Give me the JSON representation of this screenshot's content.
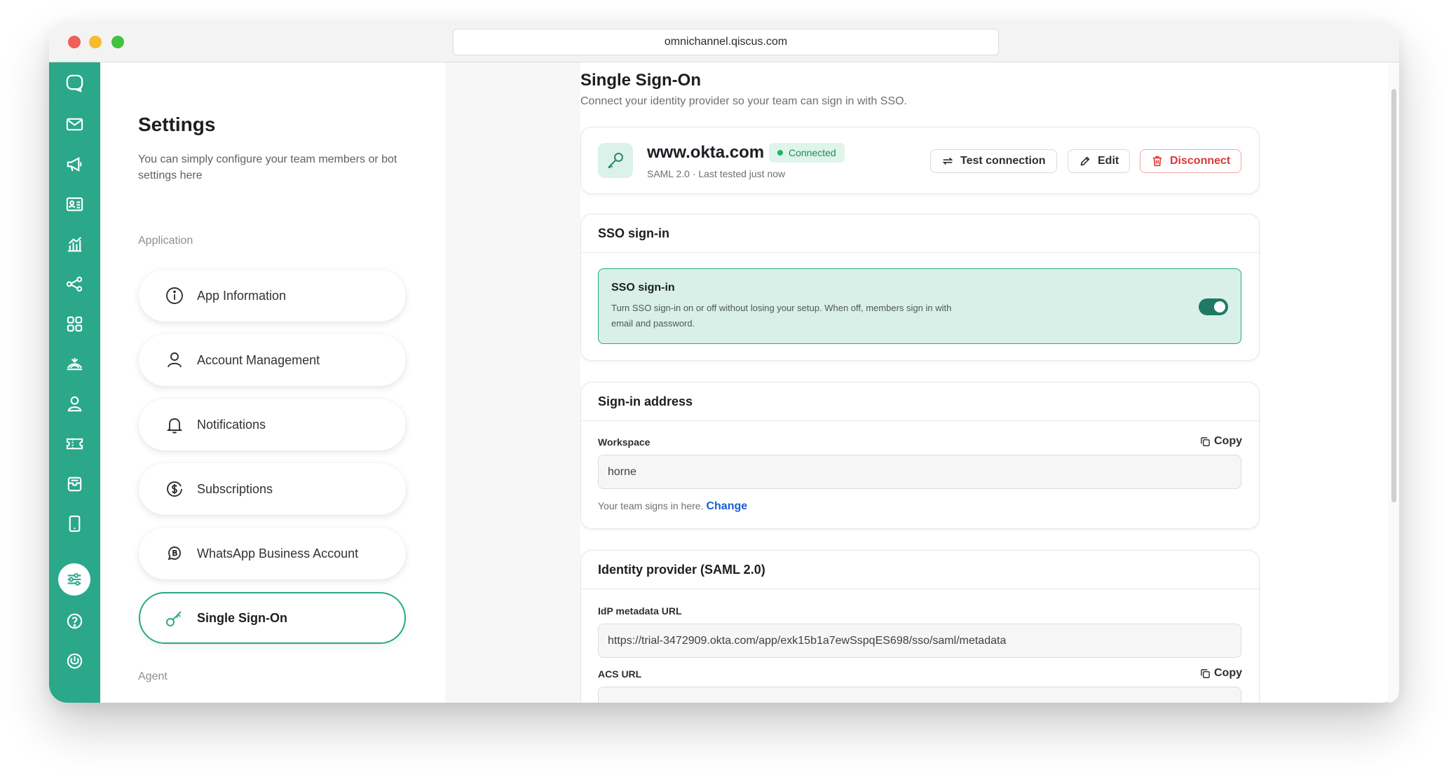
{
  "browser": {
    "url": "omnichannel.qiscus.com"
  },
  "rail": {
    "icons": [
      "chat-icon",
      "mail-icon",
      "megaphone-icon",
      "contact-card-icon",
      "analytics-icon",
      "flow-icon",
      "apps-grid-icon",
      "broadcast-icon",
      "agent-icon",
      "ticket-icon",
      "inbox-icon",
      "mobile-icon",
      "settings-sliders-icon",
      "help-icon",
      "power-icon"
    ],
    "active": "settings-sliders-icon"
  },
  "sidebar": {
    "title": "Settings",
    "description": "You can simply configure your team members or bot settings here",
    "section_application": "Application",
    "section_agent": "Agent",
    "items": [
      {
        "label": "App Information",
        "icon": "info-icon"
      },
      {
        "label": "Account Management",
        "icon": "user-icon"
      },
      {
        "label": "Notifications",
        "icon": "bell-icon"
      },
      {
        "label": "Subscriptions",
        "icon": "subscription-icon"
      },
      {
        "label": "WhatsApp Business Account",
        "icon": "whatsapp-business-icon"
      },
      {
        "label": "Single Sign-On",
        "icon": "key-icon",
        "active": true
      }
    ]
  },
  "page": {
    "title": "Single Sign-On",
    "subtitle": "Connect your identity provider so your team can sign in with SSO."
  },
  "provider": {
    "name": "www.okta.com",
    "status": "Connected",
    "meta": "SAML 2.0 · Last tested just now",
    "buttons": {
      "test": "Test connection",
      "edit": "Edit",
      "disconnect": "Disconnect"
    }
  },
  "sso": {
    "header": "SSO sign-in",
    "box_title": "SSO sign-in",
    "box_desc": "Turn SSO sign-in on or off without losing your setup. When off, members sign in with email and password.",
    "enabled": true
  },
  "signin_address": {
    "header": "Sign-in address",
    "label": "Workspace",
    "copy": "Copy",
    "value": "horne",
    "hint": "Your team signs in here.",
    "change": "Change"
  },
  "idp": {
    "header": "Identity provider (SAML 2.0)",
    "metadata_label": "IdP metadata URL",
    "metadata_value": "https://trial-3472909.okta.com/app/exk15b1a7ewSspqES698/sso/saml/metadata",
    "acs_label": "ACS URL",
    "acs_copy": "Copy"
  },
  "colors": {
    "brand": "#2aa889",
    "danger": "#d93838",
    "link": "#1a5fd0",
    "connected": "#22b36a"
  }
}
